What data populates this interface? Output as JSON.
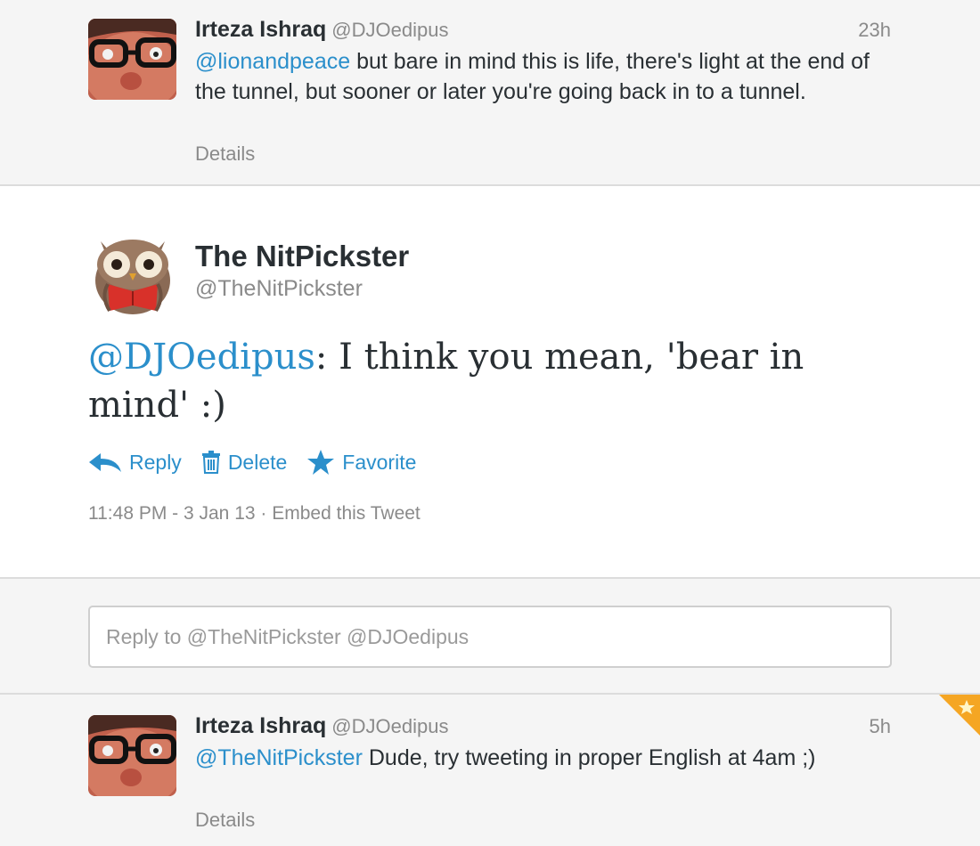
{
  "tweets": {
    "top": {
      "name": "Irteza Ishraq",
      "handle": "@DJOedipus",
      "time": "23h",
      "mention": "@lionandpeace",
      "text": " but bare in mind this is life, there's light at the end of the tunnel, but sooner or later you're going back in to a tunnel.",
      "details": "Details"
    },
    "main": {
      "name": "The NitPickster",
      "handle": "@TheNitPickster",
      "mention": "@DJOedipus",
      "text": ": I think you mean, 'bear in mind' :)",
      "actions": {
        "reply": "Reply",
        "delete": "Delete",
        "favorite": "Favorite"
      },
      "timestamp": "11:48 PM - 3 Jan 13",
      "separator": " · ",
      "embed": "Embed this Tweet"
    },
    "bottom": {
      "name": "Irteza Ishraq",
      "handle": "@DJOedipus",
      "time": "5h",
      "mention": "@TheNitPickster",
      "text": " Dude, try tweeting in proper English at 4am ;)",
      "details": "Details"
    }
  },
  "reply_box": {
    "placeholder": "Reply to @TheNitPickster @DJOedipus"
  },
  "colors": {
    "link": "#2b8fcb",
    "muted": "#8a8a8a",
    "favorite_corner": "#f5a623"
  }
}
